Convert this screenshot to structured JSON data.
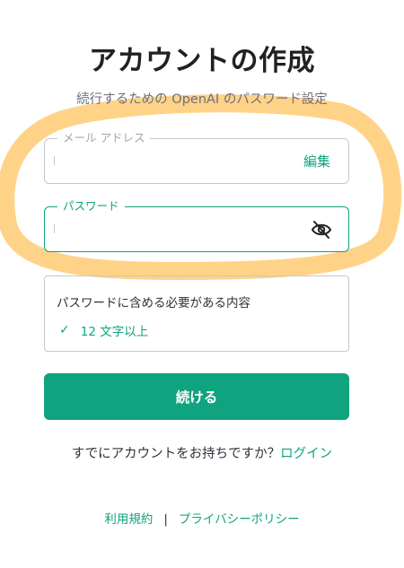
{
  "header": {
    "title": "アカウントの作成",
    "subtitle": "続行するための OpenAI のパスワード設定"
  },
  "email_field": {
    "label": "メール アドレス",
    "value": "",
    "edit_label": "編集"
  },
  "password_field": {
    "label": "パスワード",
    "value": "",
    "toggle_icon": "eye-off-icon"
  },
  "requirements": {
    "title": "パスワードに含める必要がある内容",
    "items": [
      {
        "check": "✓",
        "text": "12 文字以上"
      }
    ]
  },
  "actions": {
    "continue_label": "続ける",
    "login_prompt": "すでにアカウントをお持ちですか？",
    "login_link": "ログイン"
  },
  "footer": {
    "terms": "利用規約",
    "separator": "|",
    "privacy": "プライバシーポリシー"
  },
  "colors": {
    "accent": "#10a37f",
    "highlight": "#ffce7a"
  }
}
